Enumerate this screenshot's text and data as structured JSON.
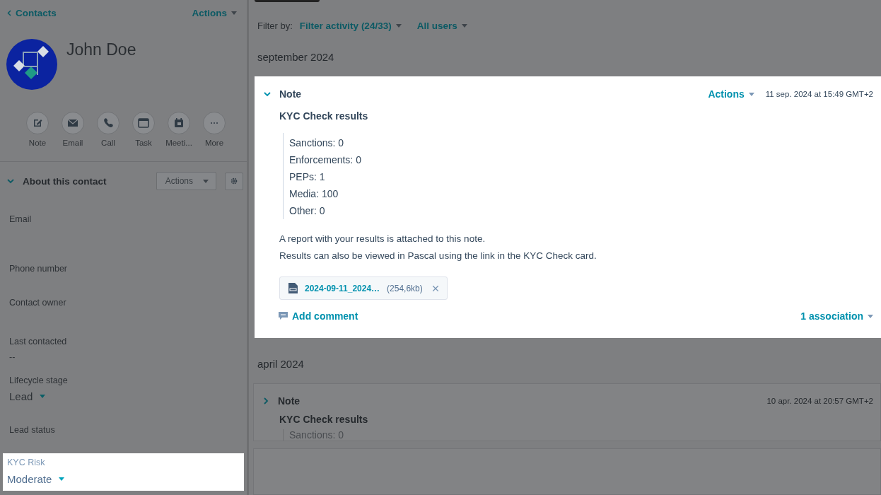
{
  "header": {
    "back_link": "Contacts",
    "actions": "Actions"
  },
  "contact": {
    "name": "John Doe"
  },
  "quick_actions": [
    {
      "label": "Note",
      "kind": "note"
    },
    {
      "label": "Email",
      "kind": "email"
    },
    {
      "label": "Call",
      "kind": "call"
    },
    {
      "label": "Task",
      "kind": "task"
    },
    {
      "label": "Meeti...",
      "kind": "meeting"
    },
    {
      "label": "More",
      "kind": "more"
    }
  ],
  "about": {
    "title": "About this contact",
    "expanded": true,
    "actions": "Actions"
  },
  "fields": [
    {
      "label": "Email",
      "kind": "text",
      "highlighted": false
    },
    {
      "label": "Phone number",
      "kind": "text",
      "highlighted": false
    },
    {
      "label": "Contact owner",
      "kind": "text",
      "highlighted": false
    },
    {
      "label": "Last contacted",
      "kind": "text",
      "value": "--",
      "highlighted": false
    },
    {
      "label": "Lifecycle stage",
      "kind": "dropdown",
      "value": "Lead",
      "highlighted": false
    },
    {
      "label": "Lead status",
      "kind": "text",
      "highlighted": false
    },
    {
      "label": "KYC Risk",
      "kind": "dropdown",
      "value": "Moderate",
      "highlighted": true
    }
  ],
  "filter": {
    "label": "Filter by:",
    "activity": "Filter activity (24/33)",
    "users": "All users"
  },
  "timeline": [
    {
      "month": "september 2024",
      "notes": [
        {
          "type_label": "Note",
          "expanded": true,
          "highlighted": true,
          "actions": "Actions",
          "timestamp": "11 sep. 2024 at 15:49 GMT+2",
          "title": "KYC Check results",
          "results": [
            "Sanctions: 0",
            "Enforcements: 0",
            "PEPs: 1",
            "Media: 100",
            "Other: 0"
          ],
          "paragraphs": [
            "A report with your results is attached to this note.",
            "Results can also be viewed in Pascal using the link in the KYC Check card."
          ],
          "attachment": {
            "name": "2024-09-11_2024…",
            "size": "(254,6kb)"
          },
          "add_comment": "Add comment",
          "associations": "1 association"
        }
      ]
    },
    {
      "month": "april 2024",
      "notes": [
        {
          "type_label": "Note",
          "expanded": false,
          "highlighted": false,
          "timestamp": "10 apr. 2024 at 20:57 GMT+2",
          "title": "KYC Check results",
          "results": [
            "Sanctions: 0"
          ]
        }
      ]
    }
  ]
}
